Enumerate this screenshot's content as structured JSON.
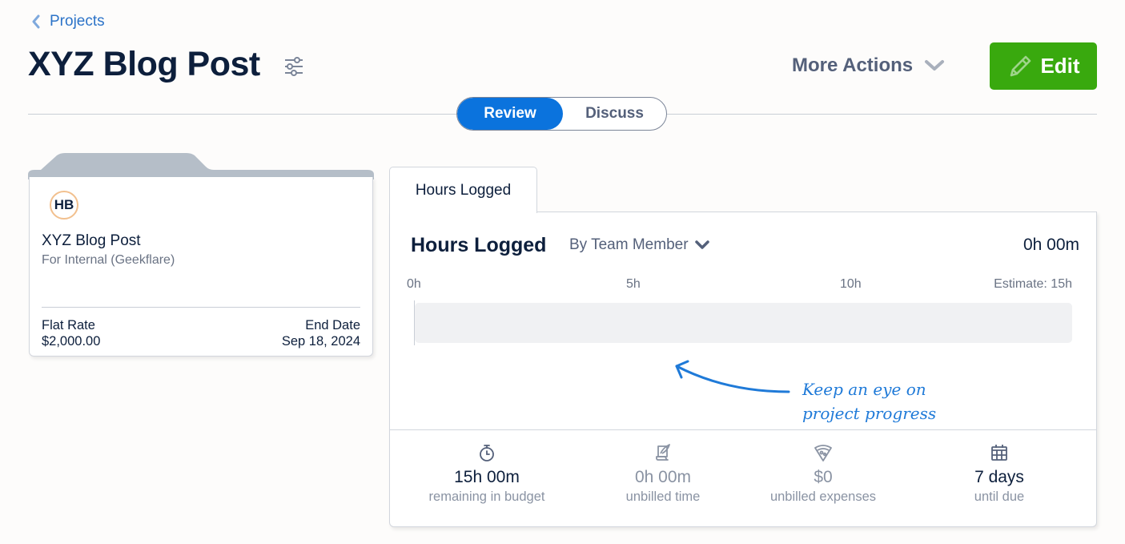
{
  "breadcrumb": {
    "label": "Projects"
  },
  "header": {
    "title": "XYZ Blog Post",
    "more_actions_label": "More Actions",
    "edit_label": "Edit"
  },
  "view_toggle": [
    {
      "label": "Review",
      "active": true
    },
    {
      "label": "Discuss",
      "active": false
    }
  ],
  "project_card": {
    "avatar_initials": "HB",
    "name": "XYZ Blog Post",
    "client": "For Internal (Geekflare)",
    "billing_label": "Flat Rate",
    "billing_value": "$2,000.00",
    "end_date_label": "End Date",
    "end_date_value": "Sep 18, 2024"
  },
  "hours_panel": {
    "tab_label": "Hours Logged",
    "title": "Hours Logged",
    "group_by": "By Team Member",
    "total": "0h 00m",
    "scale_ticks": [
      "0h",
      "5h",
      "10h",
      "Estimate: 15h"
    ],
    "logged_hours": 0,
    "estimate_hours": 15,
    "hint_line1": "Keep an eye on",
    "hint_line2": "project progress",
    "colors": {
      "accent": "#0b73dd",
      "track": "#f0f1f3",
      "hint": "#1f7ad8"
    }
  },
  "stats": [
    {
      "icon": "stopwatch-icon",
      "value": "15h 00m",
      "label": "remaining in budget"
    },
    {
      "icon": "scroll-quill-icon",
      "value": "0h 00m",
      "label": "unbilled time"
    },
    {
      "icon": "pizza-icon",
      "value": "$0",
      "label": "unbilled expenses"
    },
    {
      "icon": "calendar-icon",
      "value": "7 days",
      "label": "until due"
    }
  ],
  "colors": {
    "edit_button": "#39a90e",
    "title": "#0d1f3c",
    "link": "#2c73c8"
  }
}
